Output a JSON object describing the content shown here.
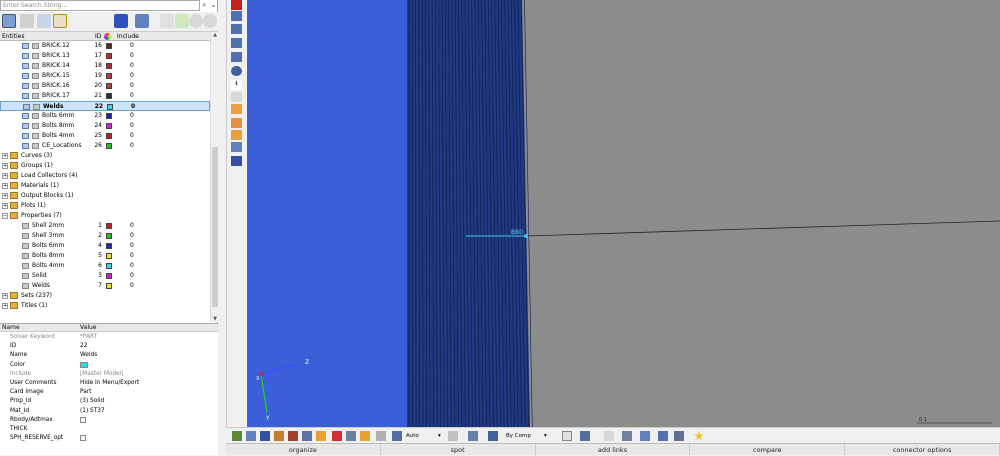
{
  "search": {
    "placeholder": "Enter Search String..."
  },
  "tree": {
    "columns": {
      "entities": "Entities",
      "id": "ID",
      "include": "Include"
    },
    "components": [
      {
        "label": "BRICK.12",
        "id": "16",
        "color": "#5a2a20",
        "include": "0"
      },
      {
        "label": "BRICK.13",
        "id": "17",
        "color": "#c02a2a",
        "include": "0"
      },
      {
        "label": "BRICK.14",
        "id": "18",
        "color": "#b82828",
        "include": "0"
      },
      {
        "label": "BRICK.15",
        "id": "19",
        "color": "#c03030",
        "include": "0"
      },
      {
        "label": "BRICK.16",
        "id": "20",
        "color": "#b83a2a",
        "include": "0"
      },
      {
        "label": "BRICK.17",
        "id": "21",
        "color": "#303030",
        "include": "0"
      },
      {
        "label": "Welds",
        "id": "22",
        "color": "#30d8e0",
        "include": "0",
        "selected": true
      },
      {
        "label": "Bolts 6mm",
        "id": "23",
        "color": "#2020c0",
        "include": "0"
      },
      {
        "label": "Bolts 8mm",
        "id": "24",
        "color": "#d020d0",
        "include": "0"
      },
      {
        "label": "Bolts 4mm",
        "id": "25",
        "color": "#b82020",
        "include": "0"
      },
      {
        "label": "CE_Locations",
        "id": "26",
        "color": "#20c020",
        "include": "0"
      }
    ],
    "groups": [
      {
        "label": "Curves (3)",
        "sign": "+"
      },
      {
        "label": "Groups (1)",
        "sign": "+"
      },
      {
        "label": "Load Collectors (4)",
        "sign": "+"
      },
      {
        "label": "Materials (1)",
        "sign": "+"
      },
      {
        "label": "Output Blocks (1)",
        "sign": "+"
      },
      {
        "label": "Plots (1)",
        "sign": "+"
      },
      {
        "label": "Properties (7)",
        "sign": "−"
      }
    ],
    "properties": [
      {
        "label": "Shell 2mm",
        "id": "1",
        "color": "#c02020",
        "include": "0"
      },
      {
        "label": "Shell 3mm",
        "id": "2",
        "color": "#20c020",
        "include": "0"
      },
      {
        "label": "Bolts 6mm",
        "id": "4",
        "color": "#2020c0",
        "include": "0"
      },
      {
        "label": "Bolts 8mm",
        "id": "5",
        "color": "#e8e020",
        "include": "0"
      },
      {
        "label": "Bolts 4mm",
        "id": "6",
        "color": "#30d8e0",
        "include": "0"
      },
      {
        "label": "Solid",
        "id": "3",
        "color": "#d020d0",
        "include": "0"
      },
      {
        "label": "Welds",
        "id": "7",
        "color": "#e8e020",
        "include": "0"
      }
    ],
    "tail": [
      {
        "label": "Sets (237)",
        "sign": "+"
      },
      {
        "label": "Titles (1)",
        "sign": "+"
      }
    ]
  },
  "properties": {
    "columns": {
      "name": "Name",
      "value": "Value"
    },
    "rows": [
      {
        "name": "Solver Keyword",
        "value": "*PART",
        "grey": true
      },
      {
        "name": "ID",
        "value": "22"
      },
      {
        "name": "Name",
        "value": "Welds"
      },
      {
        "name": "Color",
        "value": "",
        "swatch": "#30d8e0"
      },
      {
        "name": "Include",
        "value": "[Master Model]",
        "grey": true
      },
      {
        "name": "User Comments",
        "value": "Hide In Menu/Export"
      },
      {
        "name": "Card Image",
        "value": "Part"
      },
      {
        "name": "Prop_Id",
        "value": "(3) Solid"
      },
      {
        "name": "Mat_Id",
        "value": "(1) ST37"
      },
      {
        "name": "Rbody/Adtmax",
        "value": "",
        "checkbox": true
      },
      {
        "name": "THICK",
        "value": ""
      },
      {
        "name": "SPH_RESERVE_opt",
        "value": "",
        "checkbox": true
      }
    ]
  },
  "viewport": {
    "background": "#3a5fd8",
    "mesh_color": "#1f3a80",
    "gray_panel": "#8c8c8c",
    "annotation": "BB0",
    "axis_z": "Z",
    "axis_y": "Y",
    "axis_x": "X",
    "scale_label": "0.1"
  },
  "toolbar": {
    "auto1": "Auto",
    "by_comp": "By Comp"
  },
  "menu": [
    "organize",
    "spot",
    "add links",
    "compare",
    "connector options"
  ]
}
